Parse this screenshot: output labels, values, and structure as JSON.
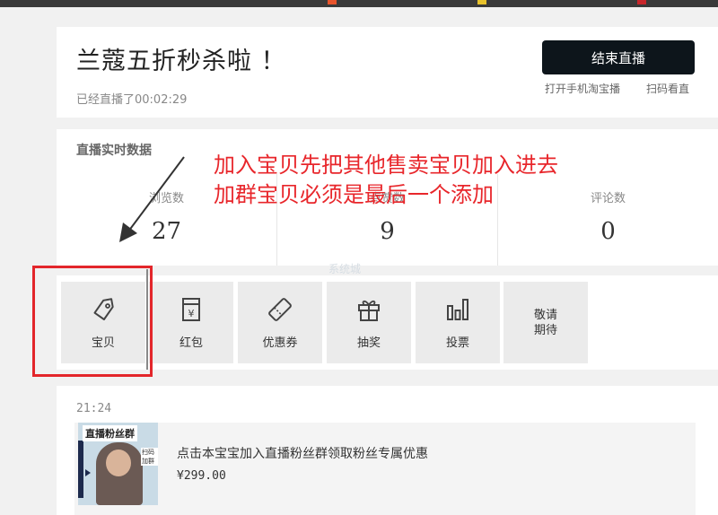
{
  "header": {
    "title": "兰蔻五折秒杀啦 ！",
    "live_duration": "已经直播了00:02:29",
    "end_button": "结束直播",
    "link_phone": "打开手机淘宝播",
    "link_scan": "扫码看直"
  },
  "stats": {
    "title": "直播实时数据",
    "items": [
      {
        "label": "浏览数",
        "value": "27"
      },
      {
        "label": "点赞数",
        "value": "9"
      },
      {
        "label": "评论数",
        "value": "0"
      }
    ]
  },
  "annotation": {
    "line1": "加入宝贝先把其他售卖宝贝加入进去",
    "line2": "加群宝贝必须是最后一个添加"
  },
  "tools": [
    {
      "label": "宝贝",
      "icon": "tag-icon"
    },
    {
      "label": "红包",
      "icon": "red-packet-icon"
    },
    {
      "label": "优惠券",
      "icon": "coupon-icon"
    },
    {
      "label": "抽奖",
      "icon": "gift-icon"
    },
    {
      "label": "投票",
      "icon": "bar-chart-icon"
    },
    {
      "label": "敬请期待",
      "icon": ""
    }
  ],
  "feed": {
    "time": "21:24",
    "product": {
      "badge": "直播粉丝群",
      "tag": "扫码加群",
      "description": "点击本宝宝加入直播粉丝群领取粉丝专属优惠",
      "price": "¥299.00"
    }
  },
  "watermark": "系统城",
  "colors": {
    "accent_red": "#e3262b",
    "button_dark": "#0d151b",
    "page_bg": "#f1f1f1"
  }
}
